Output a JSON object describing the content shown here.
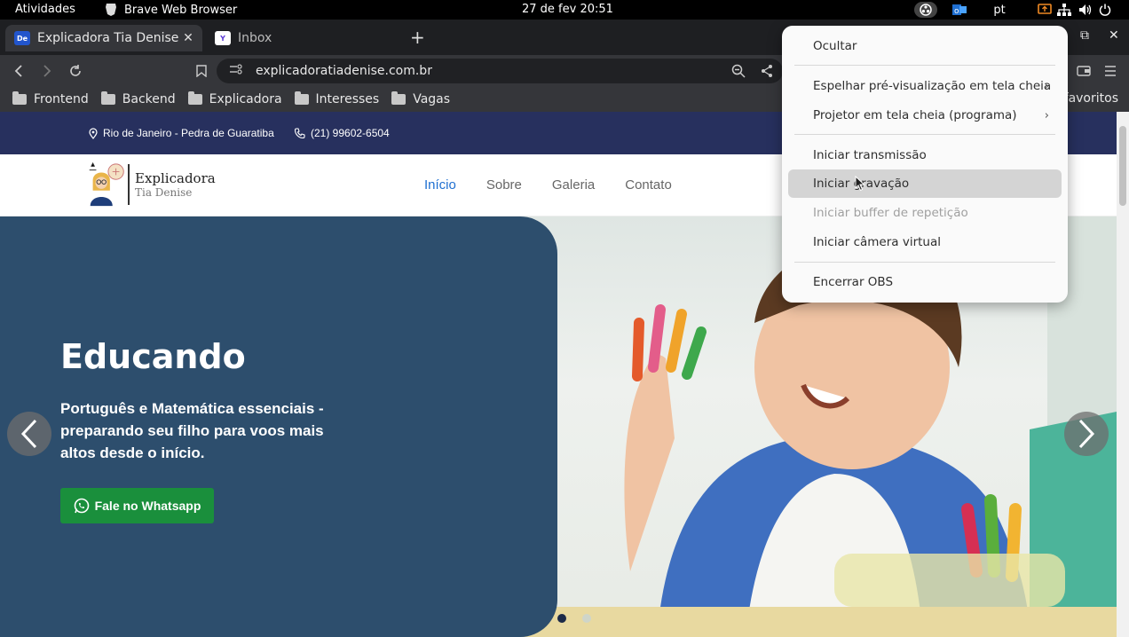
{
  "system_bar": {
    "activities": "Atividades",
    "app_name": "Brave Web Browser",
    "clock": "27 de fev  20:51",
    "language": "pt"
  },
  "browser": {
    "tabs": [
      {
        "title": "Explicadora Tia Denise - A",
        "favicon": "De",
        "active": true
      },
      {
        "title": "Inbox",
        "favicon": "Y",
        "active": false
      }
    ],
    "new_tab": "+",
    "url": "explicadoratiadenise.com.br",
    "bookmarks": [
      "Frontend",
      "Backend",
      "Explicadora",
      "Interesses",
      "Vagas"
    ],
    "bookmarks_right": "favoritos"
  },
  "site": {
    "info": {
      "location": "Rio de Janeiro - Pedra de Guaratiba",
      "phone": "(21) 99602-6504"
    },
    "logo": {
      "line1": "Explicadora",
      "line2": "Tia Denise"
    },
    "menu": [
      "Início",
      "Sobre",
      "Galeria",
      "Contato"
    ],
    "hero": {
      "title": "Educando",
      "text": "Português e Matemática essenciais - preparando seu filho para voos mais altos desde o início.",
      "button": "Fale no Whatsapp"
    },
    "carousel": {
      "slides": 2,
      "current": 1
    }
  },
  "obs_menu": {
    "items": [
      {
        "label": "Ocultar",
        "submenu": false,
        "disabled": false
      },
      {
        "label": "Espelhar pré-visualização em tela cheia",
        "submenu": true,
        "disabled": false
      },
      {
        "label": "Projetor em tela cheia (programa)",
        "submenu": true,
        "disabled": false
      },
      {
        "label": "Iniciar transmissão",
        "submenu": false,
        "disabled": false
      },
      {
        "label": "Iniciar gravação",
        "submenu": false,
        "disabled": false,
        "hover": true
      },
      {
        "label": "Iniciar buffer de repetição",
        "submenu": false,
        "disabled": true
      },
      {
        "label": "Iniciar câmera virtual",
        "submenu": false,
        "disabled": false
      },
      {
        "label": "Encerrar OBS",
        "submenu": false,
        "disabled": false
      }
    ]
  },
  "colors": {
    "infobar": "#27305e",
    "hero_card": "#2d4e6d",
    "whatsapp_button": "#1a8f3c",
    "menu_active": "#1f6fd1"
  }
}
